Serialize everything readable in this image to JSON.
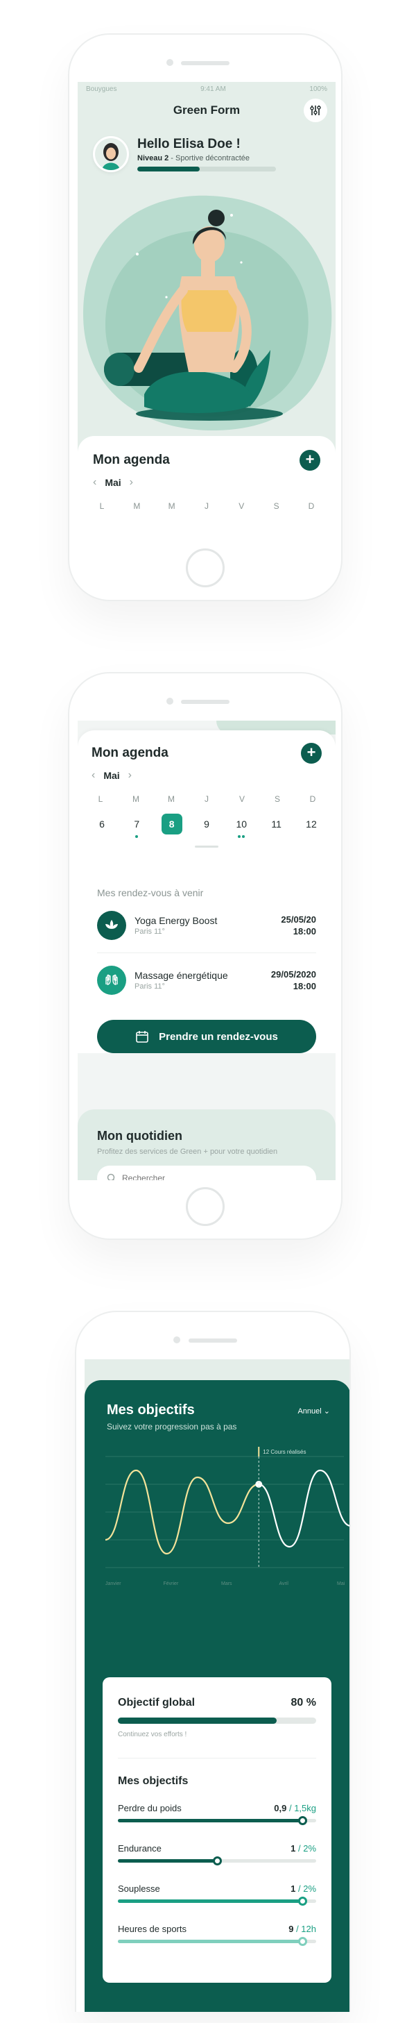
{
  "app": {
    "title": "Green Form",
    "status": {
      "carrier": "Bouygues",
      "time": "9:41 AM",
      "battery": "100%"
    }
  },
  "profile": {
    "greeting": "Hello Elisa Doe !",
    "level": "Niveau 2",
    "level_desc": " - Sportive décontractée",
    "level_progress_percent": 45
  },
  "agenda": {
    "title": "Mon agenda",
    "month": "Mai",
    "weekdays": [
      "L",
      "M",
      "M",
      "J",
      "V",
      "S",
      "D"
    ],
    "dates": [
      {
        "day": "6",
        "dots": 0
      },
      {
        "day": "7",
        "dots": 1
      },
      {
        "day": "8",
        "dots": 0,
        "selected": true
      },
      {
        "day": "9",
        "dots": 0
      },
      {
        "day": "10",
        "dots": 2
      },
      {
        "day": "11",
        "dots": 0
      },
      {
        "day": "12",
        "dots": 0
      }
    ]
  },
  "appointments": {
    "title": "Mes rendez-vous à venir",
    "items": [
      {
        "name": "Yoga Energy Boost",
        "place": "Paris 11°",
        "date": "25/05/20",
        "time": "18:00",
        "icon": "lotus-icon"
      },
      {
        "name": "Massage énergétique",
        "place": "Paris 11°",
        "date": "29/05/2020",
        "time": "18:00",
        "icon": "hands-icon"
      }
    ],
    "book_label": "Prendre un rendez-vous"
  },
  "daily": {
    "title": "Mon quotidien",
    "subtitle": "Profitez des services de Green + pour votre quotidien",
    "search_placeholder": "Rechercher"
  },
  "objectives": {
    "title": "Mes objectifs",
    "subtitle": "Suivez votre progression pas à pas",
    "period": "Annuel",
    "global_label": "Objectif global",
    "global_value": "80 %",
    "global_percent": 80,
    "encourage": "Continuez vos efforts !",
    "list_title": "Mes objectifs",
    "goals": [
      {
        "name": "Perdre du poids",
        "current": "0,9",
        "total": " / 1,5kg",
        "fraction": 0.93,
        "color": "#0c5d4f"
      },
      {
        "name": "Endurance",
        "current": "1",
        "total": " / 2%",
        "fraction": 0.5,
        "color": "#0c5d4f"
      },
      {
        "name": "Souplesse",
        "current": "1",
        "total": " / 2%",
        "fraction": 0.93,
        "color": "#1a9f83"
      },
      {
        "name": "Heures de sports",
        "current": "9",
        "total": " / 12h",
        "fraction": 0.93,
        "color": "#7fcfbd"
      }
    ]
  },
  "chart_data": {
    "type": "line",
    "title": "",
    "x": [
      "Janvier",
      "Février",
      "Mars",
      "Avril",
      "Mai"
    ],
    "series": [
      {
        "values": [
          2,
          7,
          1,
          6.5,
          3.2,
          6,
          1.5,
          7,
          3
        ]
      }
    ],
    "annotation": "12 Cours réalisés",
    "colors": {
      "line": "#f3e39a",
      "line_after": "#ffffff",
      "grid": "#2a7565"
    }
  },
  "colors": {
    "primary": "#0c5d4f",
    "accent": "#1a9f83",
    "mint_bg": "#e4eee9"
  }
}
